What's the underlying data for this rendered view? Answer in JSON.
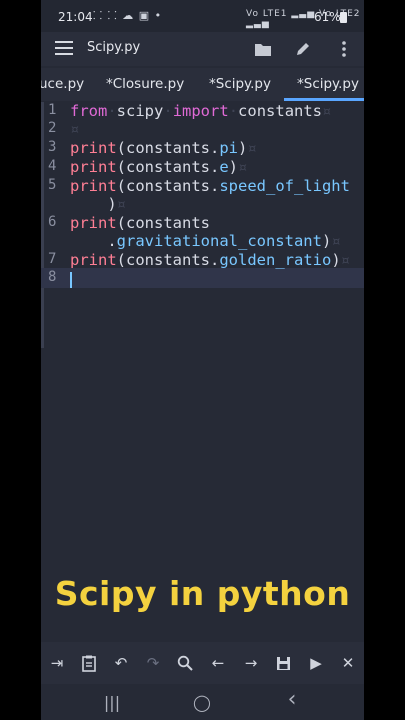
{
  "status": {
    "time": "21:04",
    "left_icons": "⸬ ⸬ ☁ ▣ •",
    "right_icons": "Vo LTE1 ▂▃▅ Vo LTE2 ▂▃▅",
    "battery": "61%"
  },
  "toolbar": {
    "title": "Scipy.py",
    "menu_icon": "hamburger-icon",
    "open_icon": "folder-icon",
    "edit_icon": "pencil-icon",
    "more_icon": "more-vertical-icon"
  },
  "tabs": [
    {
      "label": "uce.py"
    },
    {
      "label": "*Closure.py"
    },
    {
      "label": "*Scipy.py"
    },
    {
      "label": "*Scipy.py"
    }
  ],
  "editor": {
    "line_numbers": [
      "1",
      "2",
      "3",
      "4",
      "5",
      "6",
      "7",
      "8"
    ],
    "lines": {
      "l1_kw1": "from",
      "l1_mod": "scipy",
      "l1_kw2": "import",
      "l1_name": "constants",
      "l3_fn": "print",
      "l3_arg": "(constants.",
      "l3_attr": "pi",
      "l3_end": ")",
      "l4_fn": "print",
      "l4_arg": "(constants.",
      "l4_attr": "e",
      "l4_end": ")",
      "l5_fn": "print",
      "l5_arg": "(constants.",
      "l5_attr": "speed_of_light",
      "l5_end": ")",
      "l6_fn": "print",
      "l6_arg": "(constants",
      "l6_dot": ".",
      "l6_attr": "gravitational_constant",
      "l6_end": ")",
      "l7_fn": "print",
      "l7_arg": "(constants.",
      "l7_attr": "golden_ratio",
      "l7_end": ")"
    }
  },
  "caption": "Scipy in python",
  "bottom_toolbar": [
    {
      "name": "tab-indent-icon",
      "glyph": "⇥"
    },
    {
      "name": "clipboard-icon",
      "glyph": "📋"
    },
    {
      "name": "undo-icon",
      "glyph": "↶"
    },
    {
      "name": "redo-icon",
      "glyph": "↷"
    },
    {
      "name": "search-icon",
      "glyph": "🔍"
    },
    {
      "name": "arrow-left-icon",
      "glyph": "←"
    },
    {
      "name": "arrow-right-icon",
      "glyph": "→"
    },
    {
      "name": "save-icon",
      "glyph": "💾"
    },
    {
      "name": "run-icon",
      "glyph": "▶"
    },
    {
      "name": "close-icon",
      "glyph": "✕"
    }
  ],
  "navbar": {
    "recents": "|||",
    "home": "◯",
    "back": "‹"
  },
  "colors": {
    "keyword": "#e06ad6",
    "function": "#ff7f95",
    "attribute": "#79c7ff",
    "caption": "#f4d23f",
    "background": "#262a36"
  }
}
